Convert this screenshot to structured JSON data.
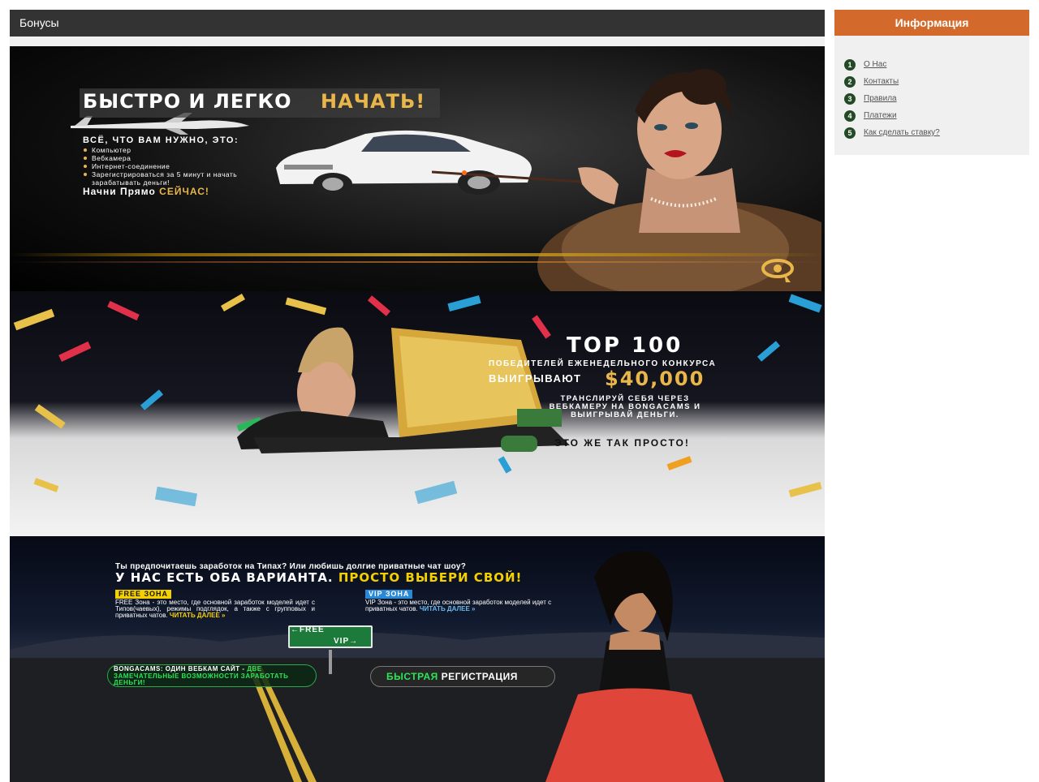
{
  "main": {
    "title": "Бонусы"
  },
  "banners": [
    {
      "headline_white": "БЫСТРО И ЛЕГКО",
      "headline_gold": "НАЧАТЬ!",
      "subheading": "ВСЁ, ЧТО ВАМ НУЖНО, ЭТО:",
      "requirements": [
        "Компьютер",
        "Вебкамера",
        "Интернет-соединение",
        "Зарегистрироваться за 5 минут и начать зарабатывать деньги!"
      ],
      "cta_white": "Начни Прямо",
      "cta_gold": "СЕЙЧАС!"
    },
    {
      "heading": "TOP 100",
      "line1": "ПОБЕДИТЕЛЕЙ ЕЖЕНЕДЕЛЬНОГО КОНКУРСА",
      "line2": "ВЫИГРЫВАЮТ",
      "prize": "$40,000",
      "line3": "ТРАНСЛИРУЙ СЕБЯ ЧЕРЕЗ ВЕБКАМЕРУ НА BONGACAMS И ВЫИГРЫВАЙ ДЕНЬГИ.",
      "line4": "ЭТО ЖЕ ТАК ПРОСТО!"
    },
    {
      "question": "Ты предпочитаешь заработок на Типах? Или любишь долгие приватные чат шоу?",
      "headline_white": "У НАС ЕСТЬ ОБА ВАРИАНТА.",
      "headline_yellow": "ПРОСТО ВЫБЕРИ СВОЙ!",
      "free_tag": "FREE ЗОНА",
      "free_text": "FREE Зона - это место, где основной заработок моделей идет с Типов(чаевых), режимы подглядок, а также с групповых и приватных чатов.",
      "free_more": "ЧИТАТЬ ДАЛЕЕ »",
      "vip_tag": "VIP ЗОНА",
      "vip_text": "VIP Зона - это место, где основной заработок моделей идет с приватных чатов.",
      "vip_more": "ЧИТАТЬ ДАЛЕЕ »",
      "sign_free": "←FREE",
      "sign_vip": "VIP→",
      "promo_white": "BONGACAMS: ОДИН ВЕБКАМ САЙТ -",
      "promo_green": "ДВЕ ЗАМЕЧАТЕЛЬНЫЕ ВОЗМОЖНОСТИ ЗАРАБОТАТЬ ДЕНЬГИ!",
      "reg_green": "БЫСТРАЯ",
      "reg_white": "РЕГИСТРАЦИЯ"
    }
  ],
  "sidebar": {
    "title": "Информация",
    "items": [
      {
        "num": "1",
        "label": "О Нас"
      },
      {
        "num": "2",
        "label": "Контакты"
      },
      {
        "num": "3",
        "label": "Правила"
      },
      {
        "num": "4",
        "label": "Платежи"
      },
      {
        "num": "5",
        "label": "Как сделать ставку?"
      }
    ]
  },
  "colors": {
    "header_dark": "#333333",
    "sidebar_accent": "#d4692c",
    "number_badge": "#234a26",
    "gold": "#e9b64a",
    "yellow": "#f5d000"
  }
}
